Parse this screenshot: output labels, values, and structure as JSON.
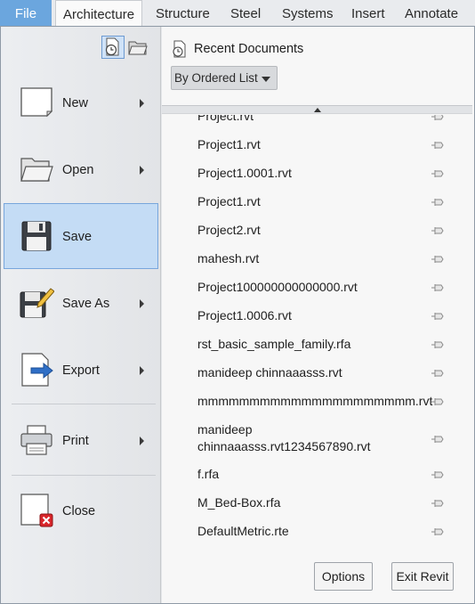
{
  "ribbon": {
    "tabs": [
      "File",
      "Architecture",
      "Structure",
      "Steel",
      "Systems",
      "Insert",
      "Annotate"
    ]
  },
  "menu": {
    "items": [
      {
        "label": "New",
        "icon": "new-document-icon",
        "has_submenu": true
      },
      {
        "label": "Open",
        "icon": "open-folder-icon",
        "has_submenu": true
      },
      {
        "label": "Save",
        "icon": "floppy-disk-icon",
        "has_submenu": false,
        "selected": true
      },
      {
        "label": "Save As",
        "icon": "save-as-pencil-icon",
        "has_submenu": true
      },
      {
        "label": "Export",
        "icon": "export-arrow-icon",
        "has_submenu": true
      },
      {
        "label": "Print",
        "icon": "printer-icon",
        "has_submenu": true
      },
      {
        "label": "Close",
        "icon": "close-document-icon",
        "has_submenu": false
      }
    ],
    "small_buttons": [
      {
        "icon": "recent-documents-icon",
        "selected": true
      },
      {
        "icon": "open-documents-icon",
        "selected": false
      }
    ]
  },
  "recent": {
    "title": "Recent Documents",
    "sort_label": "By Ordered List",
    "documents": [
      "Project.rvt",
      "Project1.rvt",
      "Project1.0001.rvt",
      "Project1.rvt",
      "Project2.rvt",
      "mahesh.rvt",
      "Project100000000000000.rvt",
      "Project1.0006.rvt",
      "rst_basic_sample_family.rfa",
      "manideep chinnaaasss.rvt",
      "mmmmmmmmmmmmmmmmmmmmm.rvt",
      "manideep chinnaaasss.rvt1234567890.rvt",
      "f.rfa",
      "M_Bed-Box.rfa",
      "DefaultMetric.rte"
    ]
  },
  "footer": {
    "options_label": "Options",
    "exit_label": "Exit Revit"
  },
  "colors": {
    "file_tab": "#6ba6de",
    "selected_item": "#c4dcf5",
    "selected_border": "#78a6dc",
    "close_badge": "#d9262b",
    "export_arrow": "#2f6fc6"
  }
}
